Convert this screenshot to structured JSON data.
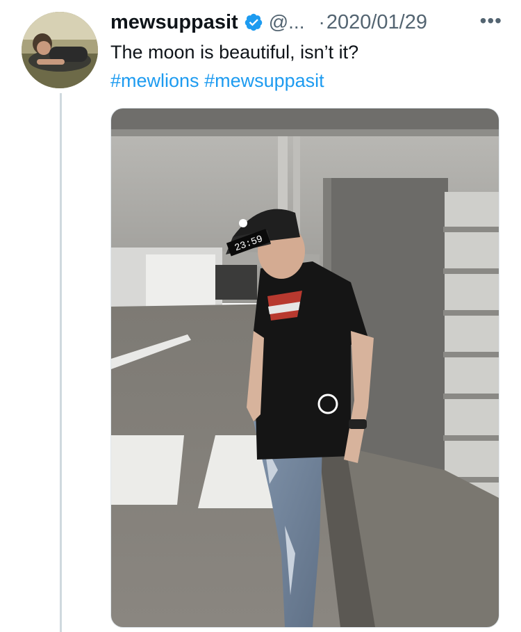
{
  "tweet": {
    "display_name": "mewsuppasit",
    "handle": "@...",
    "separator": "·",
    "date": "2020/01/29",
    "more_label": "•••",
    "text": "The moon is beautiful, isn’t it?",
    "hashtags": [
      "#mewlions",
      "#mewsuppasit"
    ]
  },
  "media": {
    "cap_overlay_text": "23:59"
  },
  "colors": {
    "hashtag": "#1d9bf0",
    "verified_badge": "#1d9bf0",
    "secondary_text": "#536471"
  },
  "icons": [
    "verified-badge-icon",
    "more-options-icon"
  ]
}
